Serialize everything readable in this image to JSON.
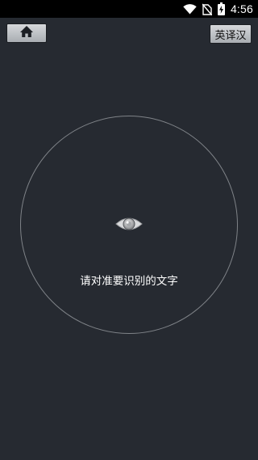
{
  "status_bar": {
    "time": "4:56",
    "icons": [
      "wifi-icon",
      "no-sim-icon",
      "battery-charging-icon"
    ]
  },
  "toolbar": {
    "home_icon": "home-icon",
    "translate_label": "英译汉"
  },
  "scanner": {
    "icon": "eye-icon",
    "prompt": "请对准要识别的文字"
  },
  "colors": {
    "background": "#262a31",
    "status_bar": "#000000",
    "button_top": "#d6d8db",
    "button_bottom": "#a9adb2",
    "circle_stroke": "#7f8388",
    "text": "#ffffff"
  }
}
